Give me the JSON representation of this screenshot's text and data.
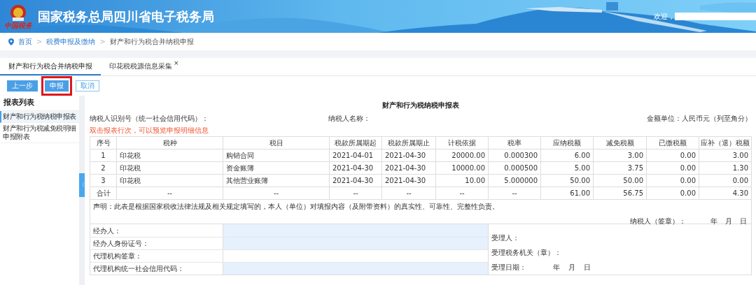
{
  "header": {
    "logo_caption": "中国税务",
    "title": "国家税务总局四川省电子税务局",
    "welcome": "欢迎，"
  },
  "breadcrumb": [
    {
      "label": "首页",
      "link": true
    },
    {
      "label": "税费申报及缴纳",
      "link": true
    },
    {
      "label": "财产和行为税合并纳税申报",
      "link": false
    }
  ],
  "breadcrumb_separator": ">",
  "tabs": [
    {
      "label": "财产和行为税合并纳税申报",
      "selected": true
    },
    {
      "label": "印花税税源信息采集",
      "selected": false,
      "close": "×"
    }
  ],
  "buttons": [
    {
      "label": "上一步",
      "kind": "primary",
      "highlighted": false
    },
    {
      "label": "申报",
      "kind": "primary",
      "highlighted": true
    },
    {
      "label": "取消",
      "kind": "outline",
      "highlighted": false
    }
  ],
  "sidebar": {
    "title": "报表列表",
    "items": [
      {
        "label": "财产和行为税纳税申报表",
        "selected": true
      },
      {
        "label": "财产和行为税减免税明细申报附表",
        "selected": false
      }
    ],
    "collapse": "〈"
  },
  "form": {
    "title": "财产和行为税纳税申报表",
    "taxpayer_id_label": "纳税人识别号（统一社会信用代码）：",
    "taxpayer_name_label": "纳税人名称：",
    "unit": "金额单位：人民币元（列至角分）",
    "hint": "双击报表行次，可以预览申报明细信息",
    "table": {
      "columns": [
        "序号",
        "税种",
        "税目",
        "税款所属期起",
        "税款所属期止",
        "计税依据",
        "税率",
        "应纳税额",
        "减免税额",
        "已缴税额",
        "应补（退）税额"
      ],
      "rows": [
        [
          "1",
          "印花税",
          "购销合同",
          "2021-04-01",
          "2021-04-30",
          "20000.00",
          "0.000300",
          "6.00",
          "3.00",
          "0.00",
          "3.00"
        ],
        [
          "2",
          "印花税",
          "资金账簿",
          "2021-04-30",
          "2021-04-30",
          "10000.00",
          "0.000500",
          "5.00",
          "3.75",
          "0.00",
          "1.30"
        ],
        [
          "3",
          "印花税",
          "其他营业账簿",
          "2021-04-30",
          "2021-04-30",
          "10.00",
          "5.000000",
          "50.00",
          "50.00",
          "0.00",
          "0.00"
        ]
      ],
      "total": [
        "合计",
        "--",
        "--",
        "--",
        "--",
        "--",
        "--",
        "61.00",
        "56.75",
        "0.00",
        "4.30"
      ]
    },
    "declaration": "声明：此表是根据国家税收法律法规及相关规定填写的，本人（单位）对填报内容（及附带资料）的真实性、可靠性、完整性负责。",
    "signature": {
      "label": "纳税人（签章）：",
      "year": "年",
      "month": "月",
      "day": "日"
    },
    "agent_rows": [
      {
        "label": "经办人：",
        "shaded": true
      },
      {
        "label": "经办人身份证号：",
        "shaded": true
      },
      {
        "label": "代理机构签章：",
        "shaded": false
      },
      {
        "label": "代理机构统一社会信用代码：",
        "shaded": true
      }
    ],
    "acceptance": {
      "receiver": "受理人：",
      "office": "受理税务机关（章）：",
      "date_label": "受理日期：",
      "year": "年",
      "month": "月",
      "day": "日"
    }
  }
}
